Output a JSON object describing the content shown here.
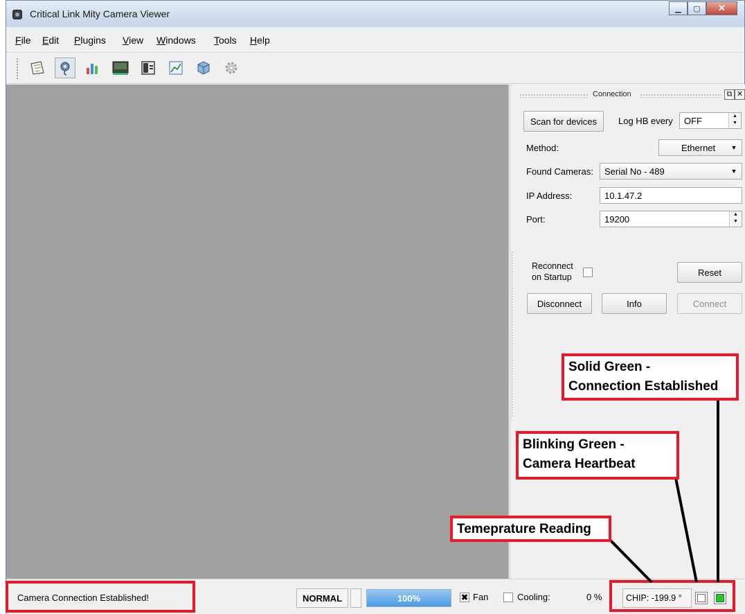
{
  "window": {
    "title": "Critical Link Mity Camera Viewer",
    "icons": {
      "app": "camera-app-icon",
      "minimize": "minimize-icon",
      "maximize": "maximize-icon",
      "close": "close-icon"
    }
  },
  "menu": {
    "items": [
      "File",
      "Edit",
      "Plugins",
      "View",
      "Windows",
      "Tools",
      "Help"
    ]
  },
  "toolbar": {
    "tools": [
      "notes-icon",
      "camera-settings-icon",
      "histogram-icon",
      "video-display-icon",
      "panel-icon",
      "chart-icon",
      "cube-icon",
      "gear-icon"
    ]
  },
  "dock": {
    "title": "Connection",
    "scan_label": "Scan for devices",
    "log_label": "Log HB every",
    "log_value": "OFF",
    "method_label": "Method:",
    "method_value": "Ethernet",
    "found_label": "Found Cameras:",
    "found_value": "Serial No - 489",
    "ip_label": "IP Address:",
    "ip_value": "10.1.47.2",
    "port_label": "Port:",
    "port_value": "19200",
    "reconnect_label_1": "Reconnect",
    "reconnect_label_2": "on Startup",
    "reset_label": "Reset",
    "disconnect_label": "Disconnect",
    "info_label": "Info",
    "connect_label": "Connect"
  },
  "status": {
    "message": "Camera Connection Established!",
    "mode": "NORMAL",
    "progress_text": "100%",
    "progress_value": 1.0,
    "fan_label": "Fan",
    "fan_checked": true,
    "cooling_label": "Cooling:",
    "cooling_value": "0 %",
    "chip_text": "CHIP: -199.9 °",
    "led_heartbeat": "blinking-green",
    "led_connection": "solid-green"
  },
  "annotations": {
    "connection": [
      "Solid Green -",
      "Connection Established"
    ],
    "heartbeat": [
      "Blinking Green -",
      "Camera Heartbeat"
    ],
    "temperature": "Temeprature Reading"
  },
  "colors": {
    "canvas": "#a0a0a0",
    "annotation_red": "#e8192c",
    "led_green": "#2fc12f",
    "progress_blue": "#4a9be3"
  }
}
